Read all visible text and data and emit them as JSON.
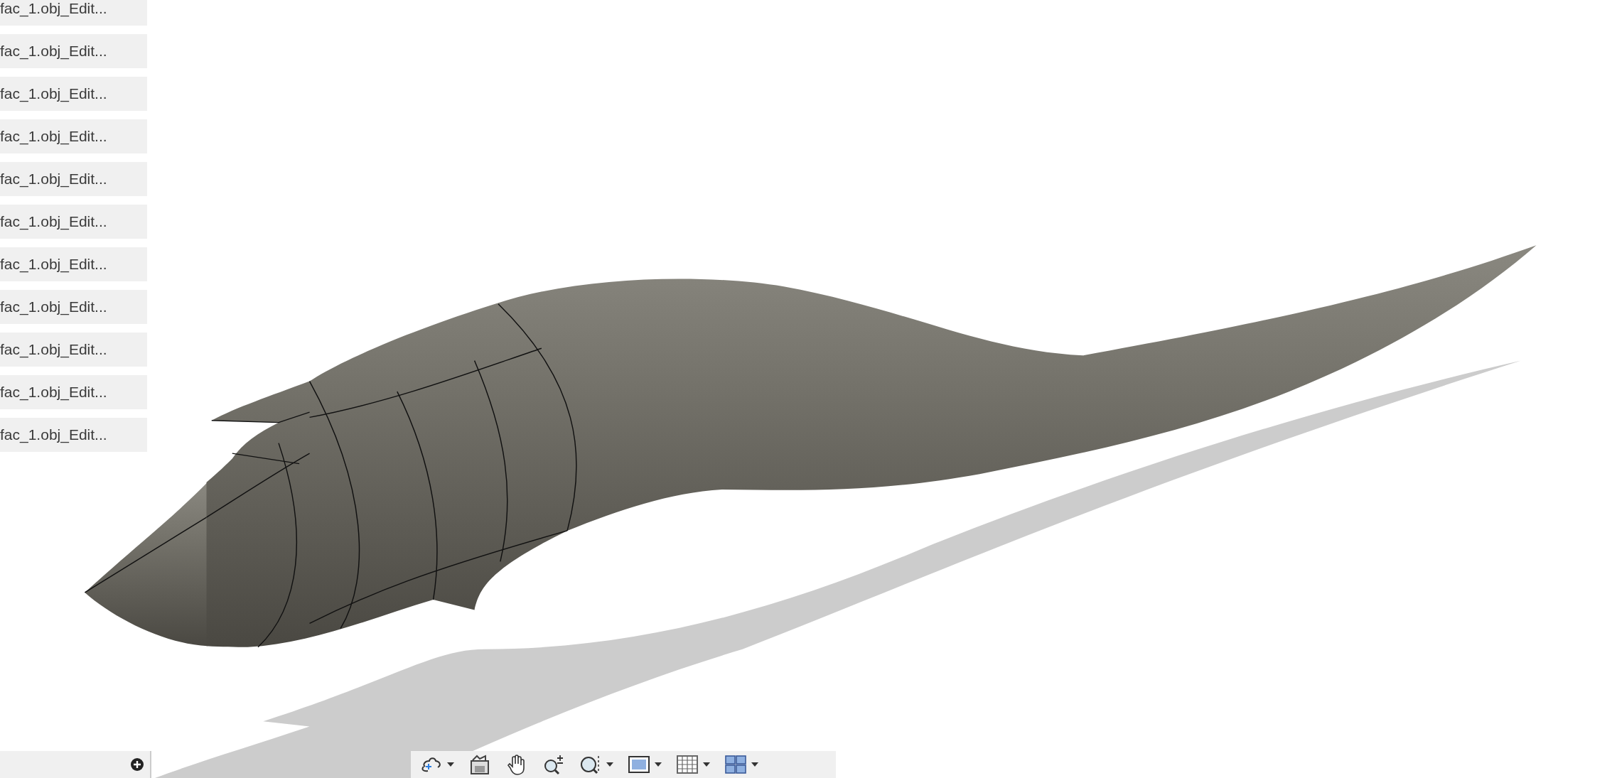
{
  "browser_items": [
    {
      "label": "fac_1.obj_Edit..."
    },
    {
      "label": "fac_1.obj_Edit..."
    },
    {
      "label": "fac_1.obj_Edit..."
    },
    {
      "label": "fac_1.obj_Edit..."
    },
    {
      "label": "fac_1.obj_Edit..."
    },
    {
      "label": "fac_1.obj_Edit..."
    },
    {
      "label": "fac_1.obj_Edit..."
    },
    {
      "label": "fac_1.obj_Edit..."
    },
    {
      "label": "fac_1.obj_Edit..."
    },
    {
      "label": "fac_1.obj_Edit..."
    },
    {
      "label": "fac_1.obj_Edit..."
    }
  ],
  "navigation_toolbar": [
    {
      "kind": "orbit",
      "dropdown": true
    },
    {
      "kind": "look-at",
      "dropdown": false
    },
    {
      "kind": "pan",
      "dropdown": false
    },
    {
      "kind": "zoom",
      "dropdown": false
    },
    {
      "kind": "fit",
      "dropdown": true
    },
    {
      "kind": "display",
      "dropdown": true
    },
    {
      "kind": "grid",
      "dropdown": true
    },
    {
      "kind": "viewports",
      "dropdown": true
    }
  ]
}
